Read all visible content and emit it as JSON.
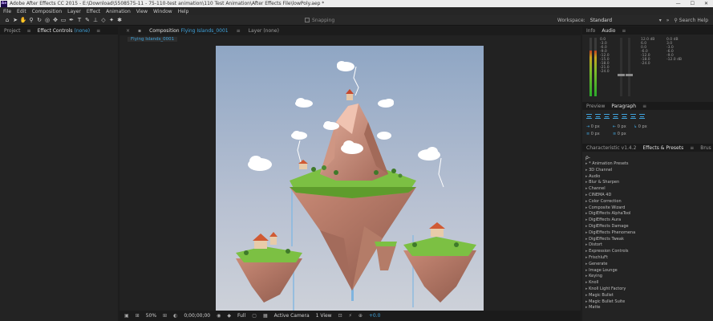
{
  "titlebar": {
    "app_icon": "Ae",
    "title": "Adobe After Effects CC 2015 - E:\\Download\\5508575-11 - 75-110-test animation\\110 Test Animation\\After Effects File\\lowPoly.aep *",
    "controls": [
      "—",
      "☐",
      "✕"
    ]
  },
  "menubar": [
    "File",
    "Edit",
    "Composition",
    "Layer",
    "Effect",
    "Animation",
    "View",
    "Window",
    "Help"
  ],
  "toolbar": {
    "tools": [
      "home-icon",
      "selection-icon",
      "hand-icon",
      "zoom-icon",
      "rotate-icon",
      "camera-orbit-icon",
      "pan-behind-icon",
      "rectangle-icon",
      "pen-icon",
      "type-icon",
      "brush-icon",
      "clone-stamp-icon",
      "eraser-icon",
      "roto-brush-icon",
      "puppet-icon"
    ],
    "snapping_label": "Snapping",
    "workspace_label": "Workspace:",
    "workspace_value": "Standard",
    "search_help": "Search Help"
  },
  "left_panel": {
    "tab_project": "Project",
    "tab_effect_controls": "Effect Controls",
    "tab_effect_controls_value": "(none)"
  },
  "composition_panel": {
    "tab_label": "Composition",
    "tab_comp_name": "Flying Islands_0001",
    "tab_layer": "Layer",
    "tab_layer_value": "(none)",
    "subtab": "Flying Islands_0001"
  },
  "viewer_bar": {
    "zoom": "50%",
    "timecode": "0;00;00;00",
    "resolution": "Full",
    "camera": "Active Camera",
    "views": "1 View",
    "exposure": "+0.0"
  },
  "audio_panel": {
    "tab_info": "Info",
    "tab_audio": "Audio",
    "left_scale": [
      "0.0",
      "-3.0",
      "-6.0",
      "-9.0",
      "-12.0",
      "-15.0",
      "-18.0",
      "-21.0",
      "-24.0"
    ],
    "right_scale": [
      "12.0 dB",
      "6.0",
      "0.0",
      "-6.0",
      "-12.0",
      "-18.0",
      "-24.0"
    ],
    "right_scale_2": [
      "0.0 dB",
      "3.0",
      "-3.0",
      "-6.0",
      "-9.0",
      "-12.0 dB"
    ],
    "meter_levels": [
      0.78,
      0.78
    ]
  },
  "paragraph_panel": {
    "tab_preview": "Preview",
    "tab_paragraph": "Paragraph",
    "indent_left": "0 px",
    "indent_right": "0 px",
    "indent_first": "0 px",
    "space_before": "0 px",
    "space_after": "0 px"
  },
  "effects_panel": {
    "tab_characteristic": "Characteristic v1.4.2",
    "tab_effects_presets": "Effects & Presets",
    "tab_brus": "Brus",
    "search_placeholder": "ρ-",
    "items": [
      "* Animation Presets",
      "3D Channel",
      "Audio",
      "Blur & Sharpen",
      "Channel",
      "CINEMA 4D",
      "Color Correction",
      "Composite Wizard",
      "DigiEffects AlphaTool",
      "DigiEffects Aura",
      "DigiEffects Damage",
      "DigiEffects Phenomena",
      "DigiEffects Tweak",
      "Distort",
      "Expression Controls",
      "FrischluFt",
      "Generate",
      "Image Lounge",
      "Keying",
      "Knoll",
      "Knoll Light Factory",
      "Magic Bullet",
      "Magic Bullet Suite",
      "Matte"
    ]
  },
  "colors": {
    "accent": "#3fa3dc",
    "panel_bg": "#232323",
    "sky_top": "#8fa7c4",
    "sky_bottom": "#c8cdd8",
    "grass": "#7cc043",
    "rock": "#c98a76"
  }
}
